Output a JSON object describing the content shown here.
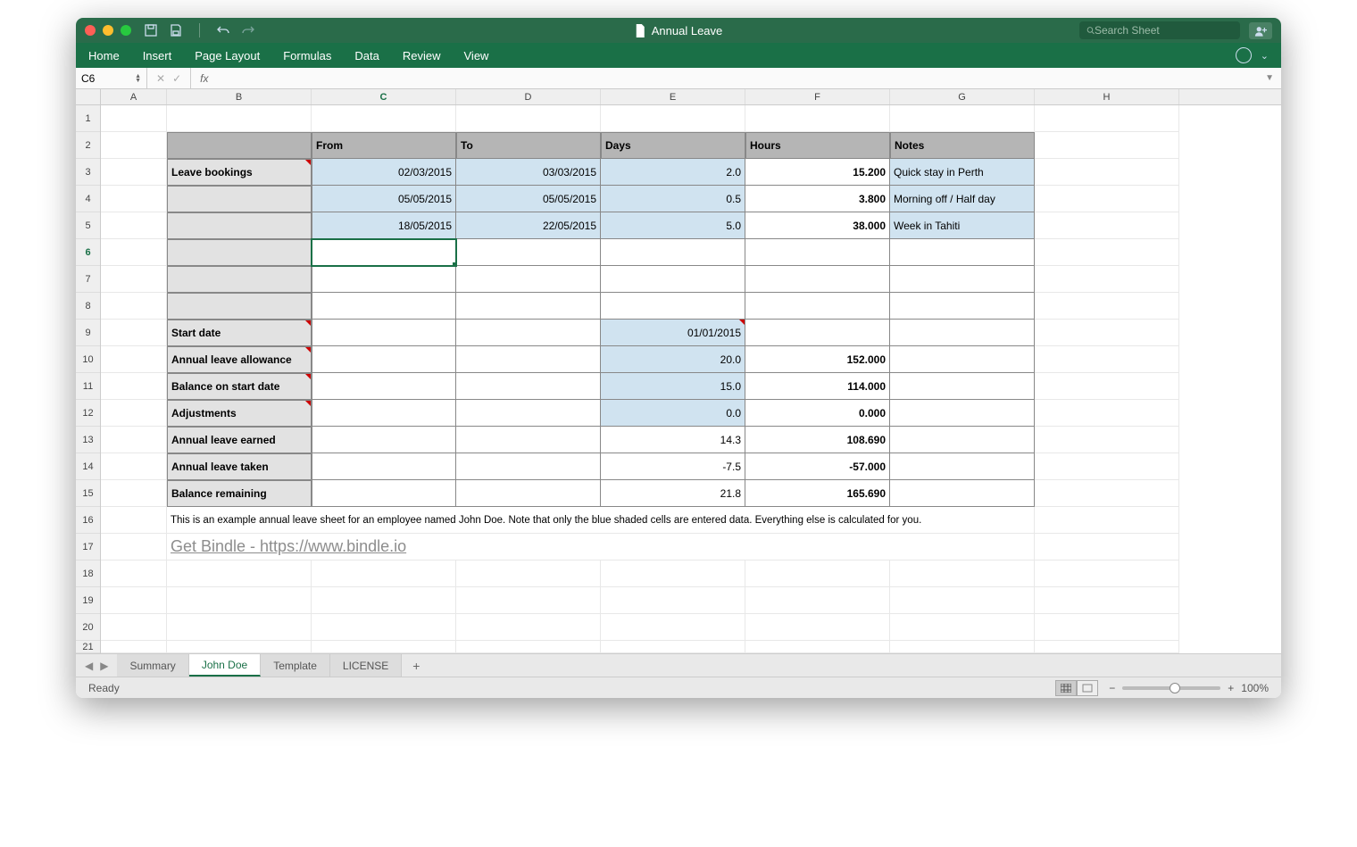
{
  "titlebar": {
    "doc_title": "Annual Leave",
    "search_placeholder": "Search Sheet"
  },
  "ribbon": {
    "tabs": [
      "Home",
      "Insert",
      "Page Layout",
      "Formulas",
      "Data",
      "Review",
      "View"
    ]
  },
  "formula": {
    "name_box": "C6",
    "fx": "fx"
  },
  "columns": [
    "A",
    "B",
    "C",
    "D",
    "E",
    "F",
    "G",
    "H"
  ],
  "active_col": "C",
  "active_row": "6",
  "row_nums": [
    "1",
    "2",
    "3",
    "4",
    "5",
    "6",
    "7",
    "8",
    "9",
    "10",
    "11",
    "12",
    "13",
    "14",
    "15",
    "16",
    "17",
    "18",
    "19",
    "20",
    "21"
  ],
  "headers": {
    "from": "From",
    "to": "To",
    "days": "Days",
    "hours": "Hours",
    "notes": "Notes"
  },
  "labels": {
    "leave_bookings": "Leave bookings",
    "start_date": "Start date",
    "allowance": "Annual leave allowance",
    "balance_start": "Balance on start date",
    "adjustments": "Adjustments",
    "earned": "Annual leave earned",
    "taken": "Annual leave taken",
    "remaining": "Balance remaining"
  },
  "bookings": [
    {
      "from": "02/03/2015",
      "to": "03/03/2015",
      "days": "2.0",
      "hours": "15.200",
      "notes": "Quick stay in Perth"
    },
    {
      "from": "05/05/2015",
      "to": "05/05/2015",
      "days": "0.5",
      "hours": "3.800",
      "notes": "Morning off / Half day"
    },
    {
      "from": "18/05/2015",
      "to": "22/05/2015",
      "days": "5.0",
      "hours": "38.000",
      "notes": "Week in Tahiti"
    }
  ],
  "summary": {
    "start_date": "01/01/2015",
    "allowance_days": "20.0",
    "allowance_hours": "152.000",
    "balance_days": "15.0",
    "balance_hours": "114.000",
    "adj_days": "0.0",
    "adj_hours": "0.000",
    "earned_days": "14.3",
    "earned_hours": "108.690",
    "taken_days": "-7.5",
    "taken_hours": "-57.000",
    "remain_days": "21.8",
    "remain_hours": "165.690"
  },
  "note_text": "This is an example annual leave sheet for an employee named John Doe. Note that only the blue shaded cells are entered data. Everything else is calculated for you.",
  "link_text": "Get Bindle - https://www.bindle.io",
  "sheet_tabs": {
    "tabs": [
      "Summary",
      "John Doe",
      "Template",
      "LICENSE"
    ],
    "active": "John Doe"
  },
  "status": {
    "text": "Ready",
    "zoom": "100%"
  }
}
